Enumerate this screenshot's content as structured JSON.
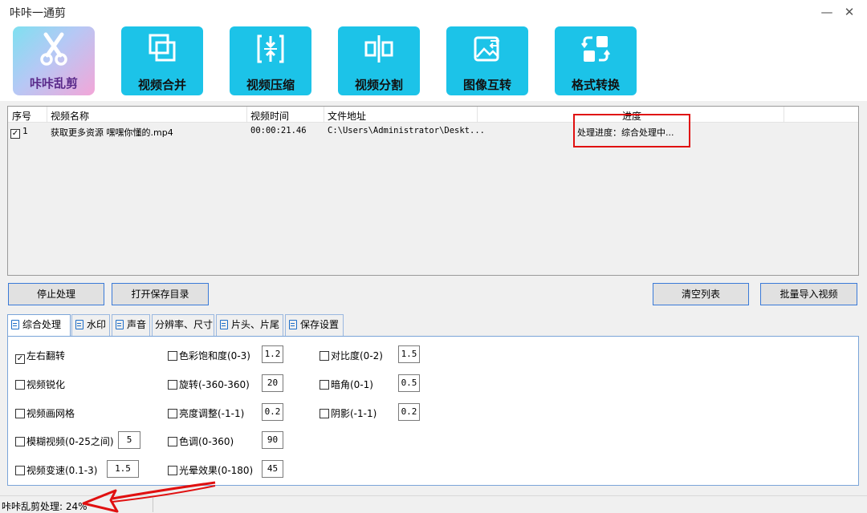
{
  "window": {
    "title": "咔咔一通剪",
    "minimize_glyph": "—",
    "close_glyph": "✕"
  },
  "toolbar": {
    "logo_label": "咔咔乱剪",
    "buttons": [
      {
        "label": "视频合并",
        "icon": "merge-icon"
      },
      {
        "label": "视频压缩",
        "icon": "compress-icon"
      },
      {
        "label": "视频分割",
        "icon": "split-icon"
      },
      {
        "label": "图像互转",
        "icon": "image-convert-icon"
      },
      {
        "label": "格式转换",
        "icon": "format-convert-icon"
      }
    ]
  },
  "list": {
    "columns": [
      "序号",
      "视频名称",
      "视频时间",
      "文件地址",
      "进度"
    ],
    "rows": [
      {
        "checked": true,
        "index": "1",
        "name": "获取更多资源 嘿嘿你懂的.mp4",
        "duration": "00:00:21.46",
        "path": "C:\\Users\\Administrator\\Deskt...",
        "progress": "处理进度：综合处理中..."
      }
    ]
  },
  "actions": {
    "stop": "停止处理",
    "open_dir": "打开保存目录",
    "clear": "清空列表",
    "import": "批量导入视频"
  },
  "tabs": [
    "综合处理",
    "水印",
    "声音",
    "分辨率、尺寸",
    "片头、片尾",
    "保存设置"
  ],
  "options": [
    {
      "label": "左右翻转",
      "checked": true
    },
    {
      "label": "视频锐化",
      "checked": false
    },
    {
      "label": "视频画网格",
      "checked": false
    },
    {
      "label": "模糊视频(0-25之间)",
      "checked": false,
      "value": "5"
    },
    {
      "label": "视频变速(0.1-3)",
      "checked": false,
      "value": "1.5"
    },
    {
      "label": "色彩饱和度(0-3)",
      "checked": false,
      "value": "1.2"
    },
    {
      "label": "旋转(-360-360)",
      "checked": false,
      "value": "20"
    },
    {
      "label": "亮度调整(-1-1)",
      "checked": false,
      "value": "0.2"
    },
    {
      "label": "色调(0-360)",
      "checked": false,
      "value": "90"
    },
    {
      "label": "光晕效果(0-180)",
      "checked": false,
      "value": "45"
    },
    {
      "label": "对比度(0-2)",
      "checked": false,
      "value": "1.5"
    },
    {
      "label": "暗角(0-1)",
      "checked": false,
      "value": "0.5"
    },
    {
      "label": "阴影(-1-1)",
      "checked": false,
      "value": "0.2"
    }
  ],
  "status": {
    "text": "咔咔乱剪处理: 24%"
  },
  "colors": {
    "accent": "#1cc3e8",
    "highlight": "#e01010"
  }
}
